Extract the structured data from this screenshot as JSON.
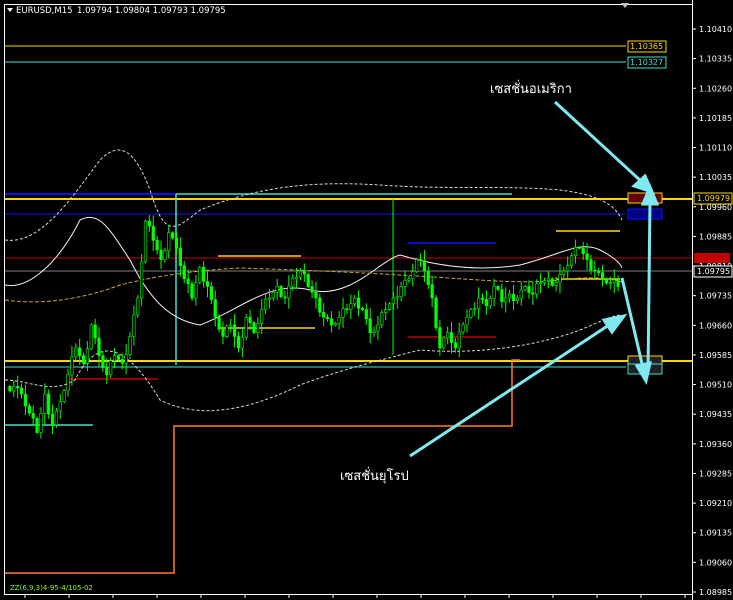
{
  "header": {
    "symbol": "EURUSD,M15",
    "ohlc": "1.09794 1.09804 1.09793 1.09795"
  },
  "indicator_label": "ZZ(6,9,3)4-95-4/105-02",
  "annotations": {
    "us_session": "เซสชั่นอเมริกา",
    "eu_session": "เซสชั่นยุโรป"
  },
  "price_axis": {
    "ticks": [
      "1.10410",
      "1.10335",
      "1.10260",
      "1.10185",
      "1.10110",
      "1.10035",
      "1.09960",
      "1.09885",
      "1.09810",
      "1.09735",
      "1.09660",
      "1.09585",
      "1.09510",
      "1.09435",
      "1.09360",
      "1.09285",
      "1.09210",
      "1.09135",
      "1.09060",
      "1.08985"
    ]
  },
  "price_labels": [
    {
      "text": "1.10365",
      "color": "#ffd700",
      "kind": "box"
    },
    {
      "text": "1.10327",
      "color": "#40e0d0",
      "kind": "box"
    },
    {
      "text": "1.09979",
      "color": "#ffd700",
      "kind": "box"
    },
    {
      "text": "1.09795",
      "color": "#ffffff",
      "kind": "current"
    }
  ],
  "colors": {
    "candle": "#00ff00",
    "level_gold": "#ffd700",
    "level_cyan": "#40e0d0",
    "level_blue": "#1010ff",
    "level_red": "#c00000",
    "orange": "#ff7f27",
    "arrow": "#7fe8f0",
    "band": "#d8d8d8",
    "ma": "#c8a820"
  },
  "chart_data": {
    "type": "candlestick",
    "symbol": "EURUSD",
    "timeframe": "M15",
    "ylim": [
      1.08985,
      1.1045
    ],
    "close_series": [
      1.0952,
      1.095,
      1.0945,
      1.094,
      1.095,
      1.0942,
      1.0948,
      1.0955,
      1.0962,
      1.0958,
      1.0968,
      1.096,
      1.0955,
      1.096,
      1.0958,
      1.0965,
      1.0975,
      1.0995,
      1.099,
      1.0985,
      1.0992,
      1.0988,
      1.098,
      1.0975,
      1.0983,
      1.0978,
      1.097,
      1.0965,
      1.0968,
      1.0962,
      1.097,
      1.0966,
      1.0972,
      1.0975,
      1.0978,
      1.0975,
      1.098,
      1.0982,
      1.0978,
      1.0975,
      1.097,
      1.0968,
      1.097,
      1.0972,
      1.0975,
      1.0972,
      1.0966,
      1.0968,
      1.0972,
      1.0975,
      1.0978,
      1.098,
      1.0985,
      1.0982,
      1.0975,
      1.0962,
      1.0966,
      1.0962,
      1.0968,
      1.0972,
      1.0975,
      1.0973,
      1.0978,
      1.0974,
      1.0976,
      1.0975,
      1.0978,
      1.0976,
      1.0979,
      1.098,
      1.0979,
      1.0982,
      1.0986,
      1.0988,
      1.0985,
      1.0982,
      1.098,
      1.0979,
      1.0978
    ],
    "horizontal_levels": [
      1.10365,
      1.10327,
      1.09979,
      1.09795,
      1.09568
    ]
  }
}
